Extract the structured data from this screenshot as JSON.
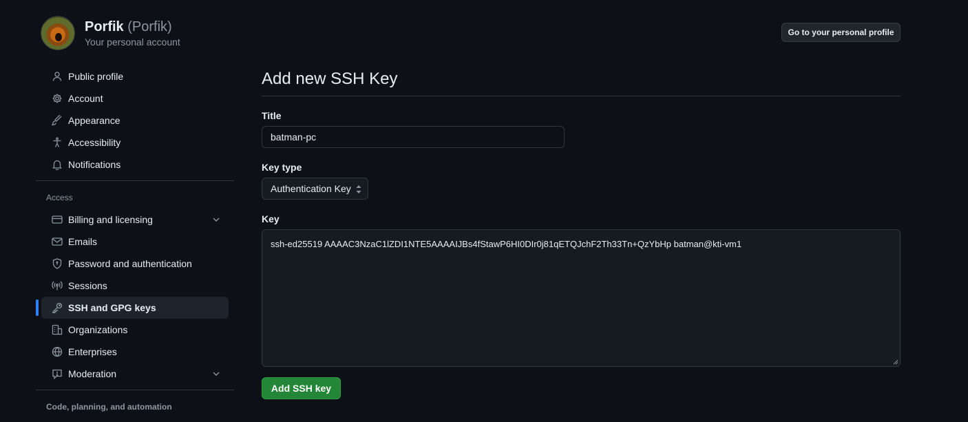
{
  "user": {
    "name": "Porfik",
    "login": "(Porfik)",
    "subtitle": "Your personal account"
  },
  "header": {
    "profile_button": "Go to your personal profile"
  },
  "sidebar": {
    "items": [
      {
        "label": "Public profile",
        "icon": "person-icon"
      },
      {
        "label": "Account",
        "icon": "gear-icon"
      },
      {
        "label": "Appearance",
        "icon": "paintbrush-icon"
      },
      {
        "label": "Accessibility",
        "icon": "accessibility-icon"
      },
      {
        "label": "Notifications",
        "icon": "bell-icon"
      }
    ],
    "access_heading": "Access",
    "access_items": [
      {
        "label": "Billing and licensing",
        "icon": "credit-card-icon",
        "expandable": true
      },
      {
        "label": "Emails",
        "icon": "mail-icon"
      },
      {
        "label": "Password and authentication",
        "icon": "shield-lock-icon"
      },
      {
        "label": "Sessions",
        "icon": "broadcast-icon"
      },
      {
        "label": "SSH and GPG keys",
        "icon": "key-icon",
        "active": true
      },
      {
        "label": "Organizations",
        "icon": "organization-icon"
      },
      {
        "label": "Enterprises",
        "icon": "globe-icon"
      },
      {
        "label": "Moderation",
        "icon": "report-icon",
        "expandable": true
      }
    ],
    "code_heading": "Code, planning, and automation"
  },
  "main": {
    "title": "Add new SSH Key",
    "title_label": "Title",
    "title_value": "batman-pc",
    "key_type_label": "Key type",
    "key_type_value": "Authentication Key",
    "key_label": "Key",
    "key_value": "ssh-ed25519 AAAAC3NzaC1lZDI1NTE5AAAAIJBs4fStawP6HI0DIr0j81qETQJchF2Th33Tn+QzYbHp batman@kti-vm1",
    "submit_label": "Add SSH key"
  },
  "colors": {
    "background": "#0d1117",
    "accent": "#2f81f7",
    "primary_button": "#238636"
  }
}
